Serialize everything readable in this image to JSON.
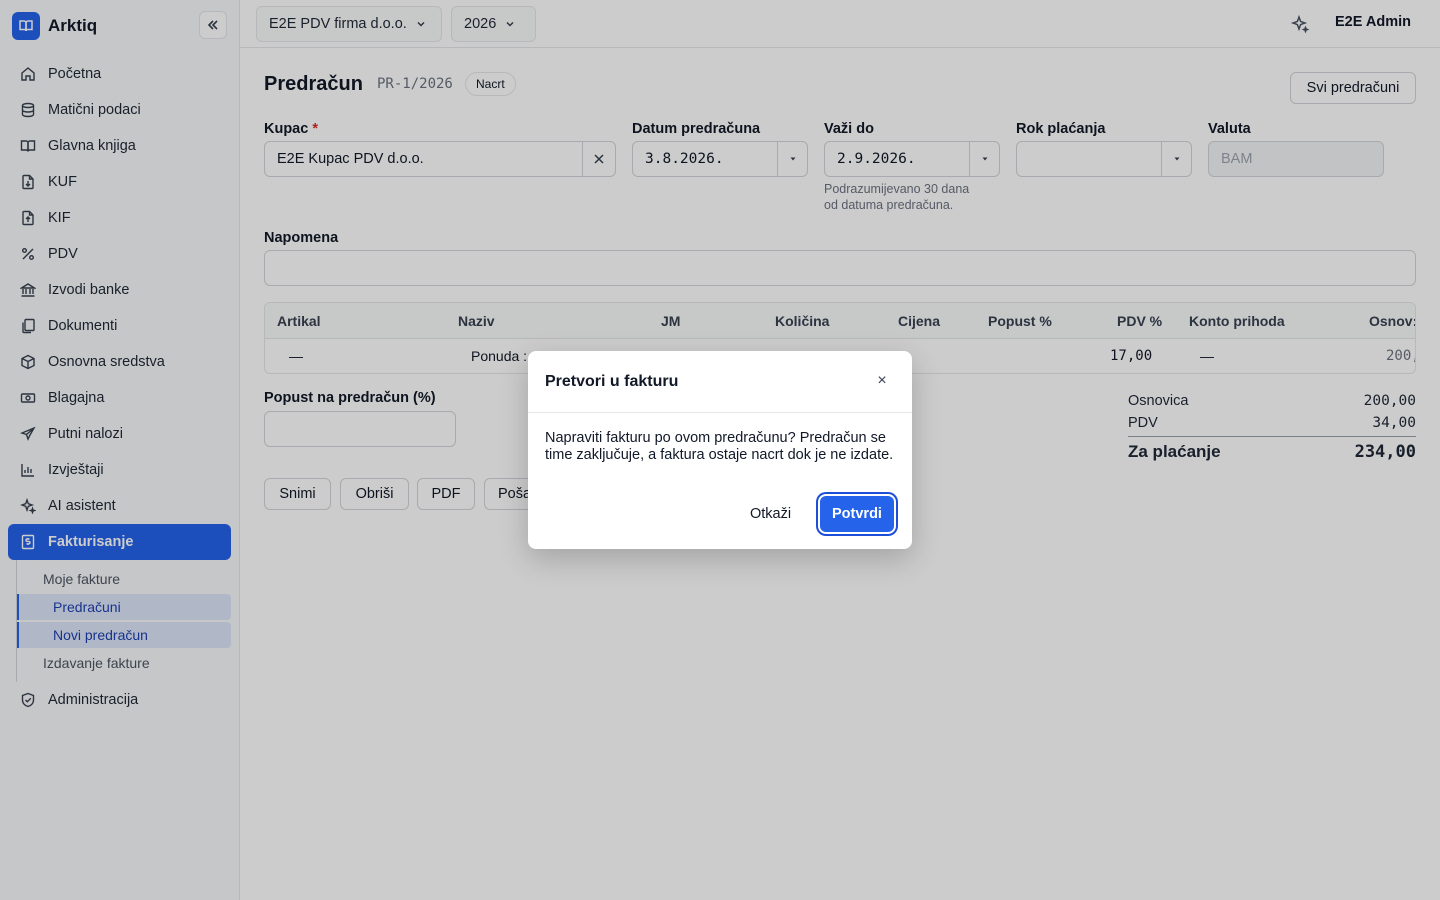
{
  "app": {
    "name": "Arktiq"
  },
  "sidebar": {
    "items": [
      {
        "label": "Početna",
        "icon": "home-icon"
      },
      {
        "label": "Matični podaci",
        "icon": "database-icon"
      },
      {
        "label": "Glavna knjiga",
        "icon": "book-icon"
      },
      {
        "label": "KUF",
        "icon": "file-in-icon"
      },
      {
        "label": "KIF",
        "icon": "file-out-icon"
      },
      {
        "label": "PDV",
        "icon": "percent-icon"
      },
      {
        "label": "Izvodi banke",
        "icon": "bank-icon"
      },
      {
        "label": "Dokumenti",
        "icon": "documents-icon"
      },
      {
        "label": "Osnovna sredstva",
        "icon": "box-icon"
      },
      {
        "label": "Blagajna",
        "icon": "cash-icon"
      },
      {
        "label": "Putni nalozi",
        "icon": "plane-icon"
      },
      {
        "label": "Izvještaji",
        "icon": "chart-icon"
      },
      {
        "label": "AI asistent",
        "icon": "sparkle-icon"
      },
      {
        "label": "Fakturisanje",
        "icon": "invoice-icon"
      }
    ],
    "sub_items": [
      "Moje fakture",
      "Predračuni",
      "Novi predračun",
      "Izdavanje fakture"
    ],
    "admin": "Administracija"
  },
  "topbar": {
    "company": "E2E PDV firma d.o.o.",
    "year": "2026",
    "user": "E2E Admin"
  },
  "page": {
    "title": "Predračun",
    "number": "PR-1/2026",
    "status": "Nacrt",
    "all_button": "Svi predračuni"
  },
  "form": {
    "customer_label": "Kupac",
    "customer_required": "*",
    "customer_value": "E2E Kupac PDV d.o.o.",
    "date_label": "Datum predračuna",
    "date_value": "3.8.2026.",
    "valid_label": "Važi do",
    "valid_value": "2.9.2026.",
    "valid_hint_1": "Podrazumijevano 30 dana",
    "valid_hint_2": "od datuma predračuna.",
    "due_label": "Rok plaćanja",
    "due_value": "",
    "currency_label": "Valuta",
    "currency_value": "BAM",
    "note_label": "Napomena",
    "note_value": "",
    "discount_label": "Popust na predračun (%)",
    "discount_value": ""
  },
  "table": {
    "headers": [
      "Artikal",
      "Naziv",
      "JM",
      "Količina",
      "Cijena",
      "Popust %",
      "PDV %",
      "Konto prihoda",
      "Osnov:"
    ],
    "row": {
      "artikal": "—",
      "naziv": "Ponuda :",
      "pdv": "17,00",
      "konto": "—",
      "osnovica": "200,"
    }
  },
  "totals": {
    "base_label": "Osnovica",
    "base_value": "200,00",
    "vat_label": "PDV",
    "vat_value": "34,00",
    "total_label": "Za plaćanje",
    "total_value": "234,00"
  },
  "actions": [
    "Snimi",
    "Obriši",
    "PDF",
    "Poša"
  ],
  "modal": {
    "title": "Pretvori u fakturu",
    "close": "×",
    "body": "Napraviti fakturu po ovom predračunu? Predračun se time zaključuje, a faktura ostaje nacrt dok je ne izdate.",
    "cancel": "Otkaži",
    "confirm": "Potvrdi"
  }
}
